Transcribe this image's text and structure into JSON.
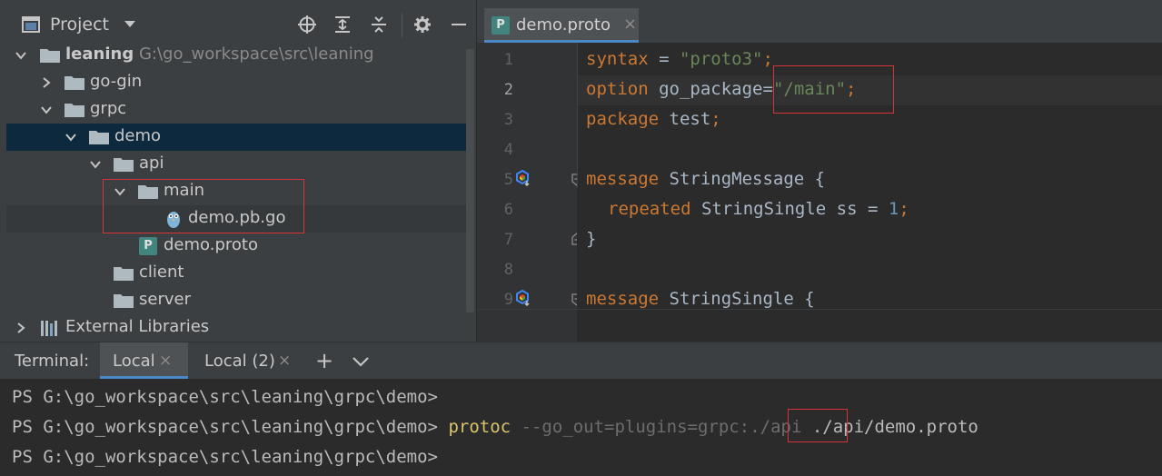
{
  "project": {
    "title": "Project",
    "tree": [
      {
        "name": "leaning",
        "path": "G:\\go_workspace\\src\\leaning"
      },
      {
        "name": "go-gin"
      },
      {
        "name": "grpc"
      },
      {
        "name": "demo"
      },
      {
        "name": "api"
      },
      {
        "name": "main"
      },
      {
        "name": "demo.pb.go"
      },
      {
        "name": "demo.proto"
      },
      {
        "name": "client"
      },
      {
        "name": "server"
      },
      {
        "name": "External Libraries"
      }
    ]
  },
  "editor": {
    "tab": {
      "label": "demo.proto",
      "icon_letter": "P"
    },
    "line_numbers": [
      "1",
      "2",
      "3",
      "4",
      "5",
      "6",
      "7",
      "8",
      "9"
    ],
    "code": {
      "l1": {
        "kw": "syntax",
        "op": " = ",
        "str": "\"proto3\"",
        "end": ";"
      },
      "l2": {
        "kw": "option",
        "mid": " go_package",
        "op": "=",
        "str": "\"/main\"",
        "end": ";"
      },
      "l3": {
        "kw": "package",
        "mid": " test",
        "end": ";"
      },
      "l5": {
        "kw": "message",
        "mid": " StringMessage {"
      },
      "l6": {
        "kw": "repeated",
        "mid": " StringSingle ss = ",
        "num": "1",
        "end": ";"
      },
      "l7": {
        "mid": "}"
      },
      "l9": {
        "kw": "message",
        "mid": " StringSingle {"
      }
    }
  },
  "terminal": {
    "label": "Terminal:",
    "tabs": [
      {
        "label": "Local"
      },
      {
        "label": "Local (2)"
      }
    ],
    "add": "+",
    "lines": [
      {
        "prompt": "PS G:\\go_workspace\\src\\leaning\\grpc\\demo>"
      },
      {
        "prompt": "PS G:\\go_workspace\\src\\leaning\\grpc\\demo>",
        "cmd": " protoc",
        "arg": " --go_out=plugins=grpc:",
        "highlight": "./api",
        "rest": " ./api/demo.proto"
      },
      {
        "prompt": "PS G:\\go_workspace\\src\\leaning\\grpc\\demo>"
      }
    ]
  },
  "colors": {
    "background": "#2b2b2b",
    "panel": "#3c3f41",
    "selection": "#0d293e",
    "keyword": "#cc7832",
    "string": "#6a8759",
    "number": "#6897bb",
    "annotation_box": "#d4343a",
    "tab_underline": "#4a88c7"
  }
}
